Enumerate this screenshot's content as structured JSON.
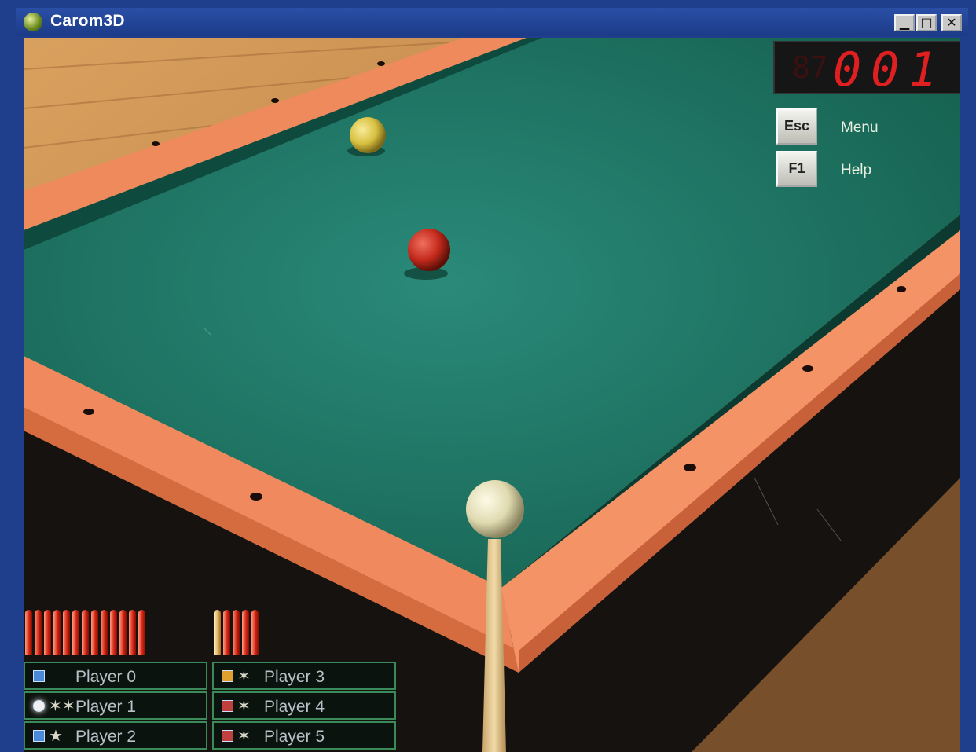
{
  "window": {
    "title": "Carom3D",
    "buttons": {
      "minimize": "▁",
      "maximize": "□",
      "close": "✕"
    }
  },
  "hud": {
    "score_small": "87",
    "score": "001",
    "keys": [
      {
        "key": "Esc",
        "label": "Menu"
      },
      {
        "key": "F1",
        "label": "Help"
      }
    ]
  },
  "players": [
    {
      "name": "Player 0",
      "mark": ""
    },
    {
      "name": "Player 1",
      "mark": "✶✶"
    },
    {
      "name": "Player 2",
      "mark": "★"
    },
    {
      "name": "Player 3",
      "mark": "✶"
    },
    {
      "name": "Player 4",
      "mark": "✶"
    },
    {
      "name": "Player 5",
      "mark": "✶"
    }
  ],
  "balls": [
    {
      "name": "yellow-ball",
      "color": "#d8c040"
    },
    {
      "name": "red-ball",
      "color": "#c42a1c"
    },
    {
      "name": "cue-ball",
      "color": "#e6e0b8"
    }
  ],
  "colors": {
    "felt": "#1e7a6a",
    "rail": "#f08a5e",
    "floor": "#c98a4e",
    "digits": "#e02020"
  }
}
